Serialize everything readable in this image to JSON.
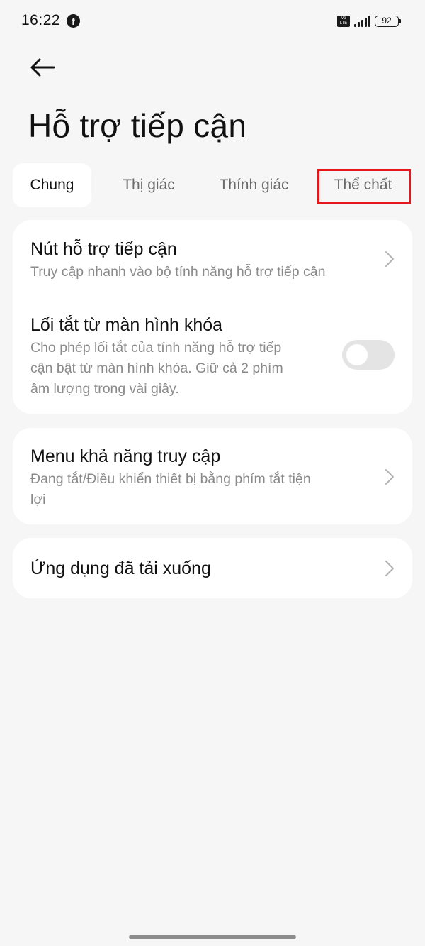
{
  "status_bar": {
    "time": "16:22",
    "network_badge_top": "Vo",
    "network_badge_bottom": "LTE",
    "battery": "92"
  },
  "header": {
    "back_icon": "arrow-left-icon",
    "title": "Hỗ trợ tiếp cận"
  },
  "tabs": [
    {
      "label": "Chung",
      "active": true
    },
    {
      "label": "Thị giác",
      "active": false
    },
    {
      "label": "Thính giác",
      "active": false
    },
    {
      "label": "Thể chất",
      "active": false,
      "highlighted": true
    }
  ],
  "highlight_color": "#e5161c",
  "sections": [
    {
      "items": [
        {
          "title": "Nút hỗ trợ tiếp cận",
          "subtitle": "Truy cập nhanh vào bộ tính năng hỗ trợ tiếp cận",
          "control": "chevron-right-icon"
        },
        {
          "title": "Lối tắt từ màn hình khóa",
          "subtitle_lines": [
            "Cho phép lối tắt của tính năng hỗ trợ tiếp",
            "cận bật từ màn hình khóa. Giữ cả 2 phím",
            "âm lượng trong vài giây."
          ],
          "control": "toggle",
          "toggle_on": false
        }
      ]
    },
    {
      "items": [
        {
          "title": "Menu khả năng truy cập",
          "subtitle_lines": [
            "Đang tắt/Điều khiển thiết bị bằng phím tắt tiện",
            "lợi"
          ],
          "control": "chevron-right-icon"
        }
      ]
    },
    {
      "items": [
        {
          "title": "Ứng dụng đã tải xuống",
          "control": "chevron-right-icon"
        }
      ]
    }
  ]
}
